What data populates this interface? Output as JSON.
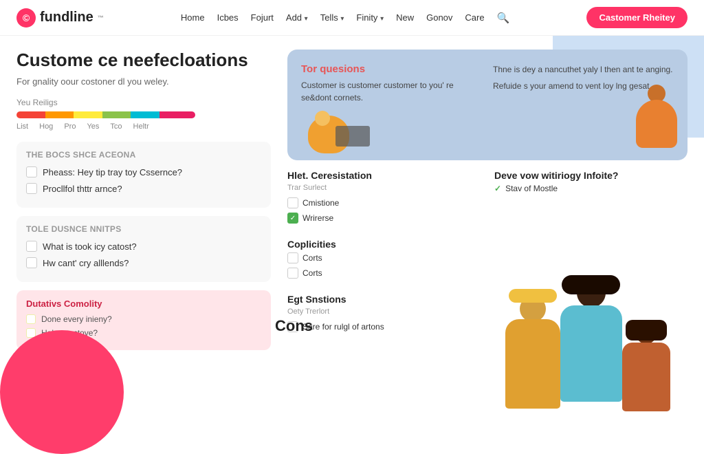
{
  "nav": {
    "logo_text": "fundline",
    "logo_icon": "©",
    "links": [
      {
        "label": "Home",
        "has_dropdown": false
      },
      {
        "label": "Icbes",
        "has_dropdown": false
      },
      {
        "label": "Fojurt",
        "has_dropdown": false
      },
      {
        "label": "Add",
        "has_dropdown": true
      },
      {
        "label": "Tells",
        "has_dropdown": true
      },
      {
        "label": "Finity",
        "has_dropdown": true
      },
      {
        "label": "New",
        "has_dropdown": false
      },
      {
        "label": "Gonov",
        "has_dropdown": false
      },
      {
        "label": "Care",
        "has_dropdown": false
      }
    ],
    "cta_label": "Castomer Rheitey"
  },
  "page": {
    "title": "Custome ce neefecloations",
    "subtitle": "For gnality oour costoner dl you weley.",
    "rating_label": "Yeu Reiligs",
    "rating_labels": [
      "List",
      "Hog",
      "Pro",
      "Yes",
      "Tco",
      "Heltr"
    ]
  },
  "section1": {
    "title": "The bocs Shce Aceona",
    "items": [
      {
        "label": "Pheass: Hey tip tray toy Cssernce?",
        "checked": false
      },
      {
        "label": "Procllfol thttr arnce?",
        "checked": false
      }
    ]
  },
  "section2": {
    "title": "Tole Dusnce Nnitps",
    "items": [
      {
        "label": "What is took icy catost?",
        "checked": false
      },
      {
        "label": "Hw cant' cry alllends?",
        "checked": false
      }
    ]
  },
  "highlight_section": {
    "title": "Dutativs Comolity",
    "items": [
      {
        "label": "Done every inieny?"
      },
      {
        "label": "Haley yoctove?"
      }
    ]
  },
  "hero": {
    "title": "Tor quesions",
    "left_text": "Customer is customer customer to you' re se&dont cornets.",
    "right_text": "Thne is dey a nancuthet yaly l then ant te anging.",
    "right_text2": "Refuide s your amend to vent loy lng gesat."
  },
  "panel1": {
    "title": "Hlet. Ceresistation",
    "subtitle": "Trar Surlect",
    "items": [
      {
        "label": "Cmistione",
        "checked": false
      },
      {
        "label": "Wrirerse",
        "checked": true
      }
    ]
  },
  "panel2": {
    "title": "Deve vow witiriogy Infoite?",
    "subtitle": "",
    "check_item": "Stav of Mostle"
  },
  "complications": {
    "title": "Coplicities",
    "items": [
      {
        "label": "Corts",
        "checked": false
      },
      {
        "label": "Corts",
        "checked": false
      }
    ]
  },
  "egt_snstions": {
    "title": "Egt Snstions",
    "subtitle": "Oety Trerlort",
    "items": [
      {
        "label": "Sare for rulgl of artons",
        "checked": false
      }
    ]
  },
  "cons_overlay": "Cons",
  "colors": {
    "brand": "#ff3366",
    "rating_colors": [
      "#f44336",
      "#ff9800",
      "#ffeb3b",
      "#8bc34a",
      "#00bcd4",
      "#e91e63"
    ]
  }
}
